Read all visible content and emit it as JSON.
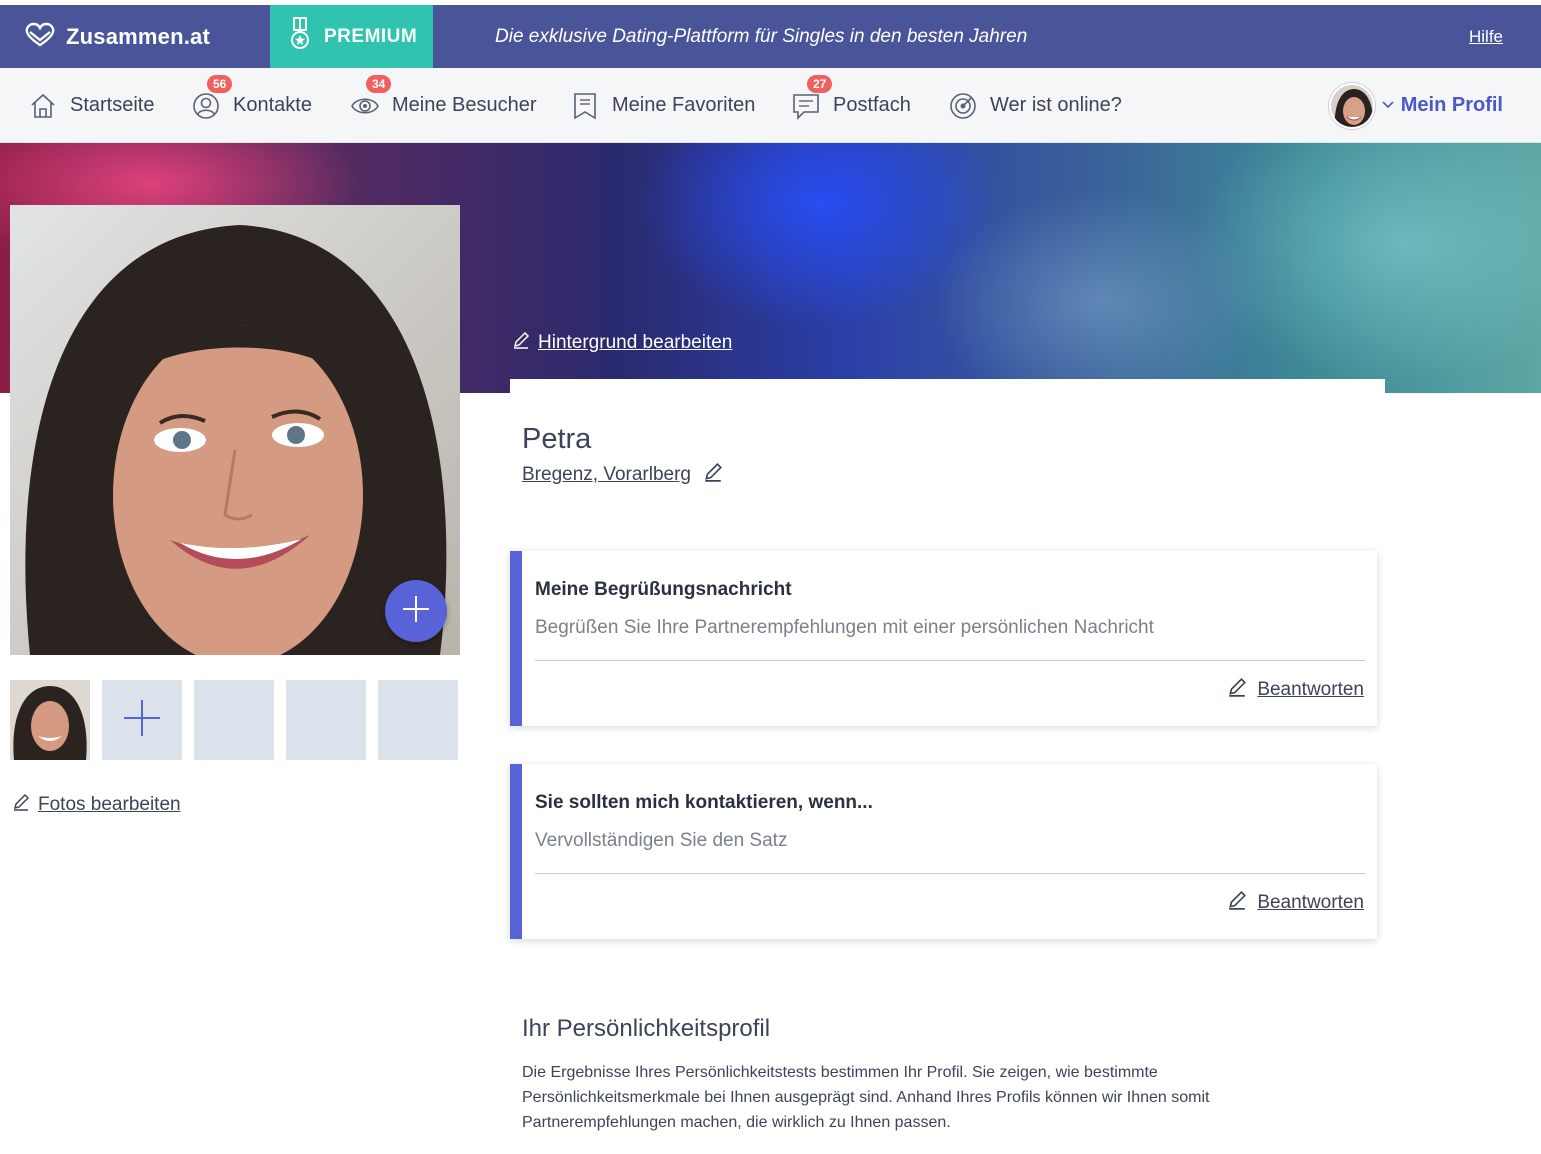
{
  "topbar": {
    "logo_text": "Zusammen.at",
    "premium_label": "PREMIUM",
    "tagline": "Die exklusive Dating-Plattform für Singles in den besten Jahren",
    "help_label": "Hilfe"
  },
  "nav": {
    "items": [
      {
        "label": "Startseite",
        "icon": "home-icon"
      },
      {
        "label": "Kontakte",
        "icon": "contacts-icon",
        "badge": "56"
      },
      {
        "label": "Meine Besucher",
        "icon": "eye-icon",
        "badge": "34"
      },
      {
        "label": "Meine Favoriten",
        "icon": "bookmark-icon"
      },
      {
        "label": "Postfach",
        "icon": "message-icon",
        "badge": "27"
      },
      {
        "label": "Wer ist online?",
        "icon": "radar-icon"
      }
    ],
    "profile_label": "Mein Profil"
  },
  "hero": {
    "edit_background_label": "Hintergrund bearbeiten"
  },
  "photos": {
    "edit_label": "Fotos bearbeiten"
  },
  "profile": {
    "name": "Petra",
    "location": "Bregenz, Vorarlberg"
  },
  "questions": [
    {
      "title": "Meine Begrüßungsnachricht",
      "subtitle": "Begrüßen Sie Ihre Partnerempfehlungen mit einer persönlichen Nachricht",
      "action": "Beantworten"
    },
    {
      "title": "Sie sollten mich kontaktieren, wenn...",
      "subtitle": "Vervollständigen Sie den Satz",
      "action": "Beantworten"
    }
  ],
  "personality": {
    "title": "Ihr Persönlichkeitsprofil",
    "text": "Die Ergebnisse Ihres Persönlichkeitstests bestimmen Ihr Profil. Sie zeigen, wie bestimmte Persönlichkeitsmerkmale bei Ihnen ausgeprägt sind. Anhand Ihres Profils können wir Ihnen somit Partnerempfehlungen machen, die wirklich zu Ihnen passen."
  },
  "colors": {
    "topbar": "#4a5599",
    "premium": "#2fc3b0",
    "accent": "#5763d6",
    "badge": "#f0605f"
  }
}
